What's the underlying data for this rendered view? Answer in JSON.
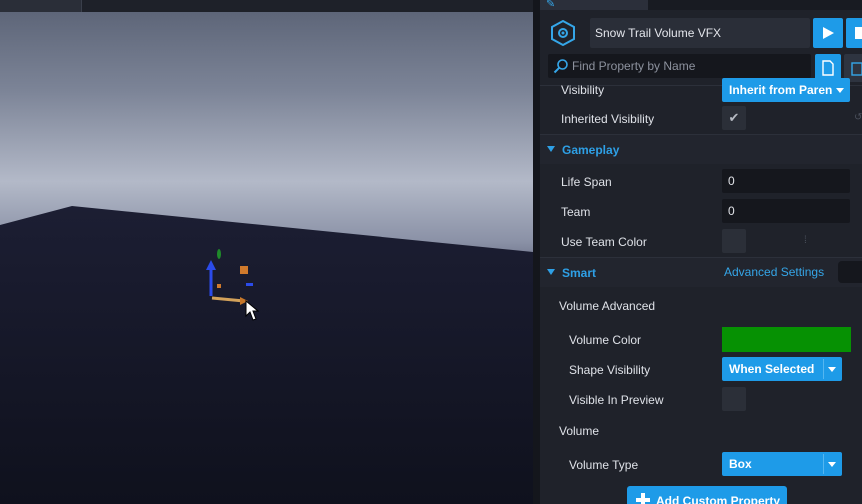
{
  "header": {
    "object_name": "Snow Trail Volume VFX",
    "search_placeholder": "Find Property by Name"
  },
  "properties": {
    "visibility": {
      "label": "Visibility",
      "value": "Inherit from Paren"
    },
    "inherited_visibility": {
      "label": "Inherited Visibility",
      "checked": true,
      "check_glyph": "✔"
    },
    "gameplay": {
      "title": "Gameplay",
      "life_span": {
        "label": "Life Span",
        "value": "0"
      },
      "team": {
        "label": "Team",
        "value": "0"
      },
      "use_team_color": {
        "label": "Use Team Color"
      }
    },
    "smart": {
      "title": "Smart",
      "advanced_link": "Advanced Settings",
      "volume_advanced_title": "Volume Advanced",
      "volume_color": {
        "label": "Volume Color",
        "color": "#069103"
      },
      "shape_visibility": {
        "label": "Shape Visibility",
        "value": "When Selected"
      },
      "visible_in_preview": {
        "label": "Visible In Preview"
      },
      "volume_title": "Volume",
      "volume_type": {
        "label": "Volume Type",
        "value": "Box"
      }
    }
  },
  "footer": {
    "add_custom_property": "Add Custom Property"
  },
  "colors": {
    "accent": "#1e9be8",
    "section_title": "#2ea0e6",
    "subsection_title": "#e1893a",
    "panel_bg": "#1f222a"
  },
  "icons": [
    "object-icon",
    "play-icon",
    "stop-icon",
    "search-icon",
    "copy-icon",
    "paste-icon",
    "plus-icon",
    "cursor-icon",
    "transform-gizmo-icon"
  ]
}
